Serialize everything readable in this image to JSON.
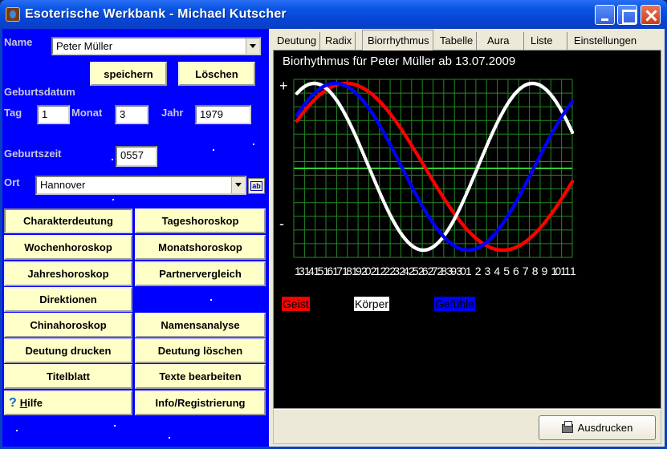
{
  "window": {
    "title": "Esoterische Werkbank - Michael Kutscher"
  },
  "form": {
    "name_label": "Name",
    "name_value": "Peter Müller",
    "save_label": "speichern",
    "delete_label": "Löschen",
    "birthdate_label": "Geburtsdatum",
    "day_label": "Tag",
    "day_value": "1",
    "month_label": "Monat",
    "month_value": "3",
    "year_label": "Jahr",
    "year_value": "1979",
    "birthtime_label": "Geburtszeit",
    "birthtime_value": "0557",
    "place_label": "Ort",
    "place_value": "Hannover",
    "place_button_icon": "ab-text-icon",
    "place_button_text": "ab"
  },
  "menu": {
    "charakterdeutung": "Charakterdeutung",
    "tageshoroskop": "Tageshoroskop",
    "wochenhoroskop": "Wochenhoroskop",
    "monatshoroskop": "Monatshoroskop",
    "jahreshoroskop": "Jahreshoroskop",
    "partnervergleich": "Partnervergleich",
    "direktionen": "Direktionen",
    "chinahoroskop": "Chinahoroskop",
    "namensanalyse": "Namensanalyse",
    "deutung_drucken": "Deutung drucken",
    "deutung_loeschen": "Deutung löschen",
    "titelblatt": "Titelblatt",
    "texte_bearbeiten": "Texte bearbeiten",
    "hilfe_icon": "question-mark-icon",
    "hilfe_glyph": "?",
    "hilfe_first": "H",
    "hilfe_rest": "ilfe",
    "info": "Info/Registrierung"
  },
  "tabs": [
    {
      "label": "Deutung"
    },
    {
      "label": "Radix"
    },
    {
      "label": "Biorrhythmus"
    },
    {
      "label": "Tabelle"
    },
    {
      "label": "Aura"
    },
    {
      "label": "Liste"
    },
    {
      "label": "Einstellungen"
    }
  ],
  "active_tab": "Biorrhythmus",
  "print_button_label": "Ausdrucken",
  "print_icon": "printer-icon",
  "colors": {
    "geist": "#ff0000",
    "koerper": "#ffffff",
    "gefuehle": "#0000ff",
    "grid": "#228b22",
    "background": "#000000",
    "panel": "#0000ff"
  },
  "chart_data": {
    "type": "line",
    "title": "Biorhythmus für Peter Müller ab 13.07.2009",
    "y_labels": {
      "top": "+",
      "bottom": "-"
    },
    "ylim": [
      -1,
      1
    ],
    "x": [
      13,
      14,
      15,
      16,
      17,
      18,
      19,
      20,
      21,
      22,
      23,
      24,
      25,
      26,
      27,
      28,
      29,
      30,
      31,
      1,
      2,
      3,
      4,
      5,
      6,
      7,
      8,
      9,
      10,
      11
    ],
    "x_tick_labels": [
      "1",
      "1",
      "1",
      "1",
      "1",
      "1",
      "1",
      "2",
      "2",
      "2",
      "2",
      "2",
      "2",
      "2",
      "2",
      "2",
      "3",
      "3",
      "1",
      "2",
      "3",
      "4",
      "5",
      "6",
      "7",
      "8",
      "9",
      "1",
      "1",
      "1"
    ],
    "x_tick_labels_2": [
      "3",
      "4",
      "5",
      "6",
      "7",
      "8",
      "9",
      "0",
      "1",
      "2",
      "3",
      "4",
      "5",
      "6",
      "7",
      "8",
      "9",
      "0",
      "",
      "",
      "",
      "",
      "",
      "",
      "",
      "",
      "",
      "0",
      "1",
      ""
    ],
    "grid": true,
    "series": [
      {
        "name": "Geist",
        "color": "#ff0000",
        "period": 33,
        "values": [
          0.55,
          0.72,
          0.85,
          0.95,
          1.0,
          0.99,
          0.94,
          0.85,
          0.72,
          0.55,
          0.37,
          0.18,
          -0.02,
          -0.21,
          -0.41,
          -0.58,
          -0.74,
          -0.86,
          -0.95,
          -1.0,
          -0.99,
          -0.95,
          -0.87,
          -0.76,
          -0.62,
          -0.46,
          -0.28,
          -0.09,
          0.1,
          0.27
        ]
      },
      {
        "name": "Körper",
        "color": "#ffffff",
        "period": 23,
        "values": [
          0.88,
          0.98,
          0.98,
          0.87,
          0.68,
          0.43,
          0.14,
          -0.14,
          -0.43,
          -0.68,
          -0.87,
          -0.98,
          -0.98,
          -0.89,
          -0.7,
          -0.46,
          -0.18,
          0.1,
          0.4,
          0.65,
          0.85,
          0.97,
          1.0,
          0.92,
          0.73,
          0.5,
          0.22,
          -0.07,
          -0.35,
          -0.6
        ]
      },
      {
        "name": "Gefühle",
        "color": "#0000ff",
        "period": 28,
        "values": [
          0.62,
          0.79,
          0.9,
          0.97,
          1.0,
          0.97,
          0.9,
          0.78,
          0.62,
          0.43,
          0.22,
          0.0,
          -0.22,
          -0.43,
          -0.62,
          -0.78,
          -0.9,
          -0.97,
          -1.0,
          -0.97,
          -0.9,
          -0.78,
          -0.62,
          -0.43,
          -0.22,
          0.0,
          0.22,
          0.43,
          0.62,
          0.78
        ]
      }
    ],
    "legend": [
      {
        "label": "Geist",
        "color": "#ff0000"
      },
      {
        "label": "Körper",
        "color": "#ffffff"
      },
      {
        "label": "Gefühle",
        "color": "#0000ff"
      }
    ]
  }
}
